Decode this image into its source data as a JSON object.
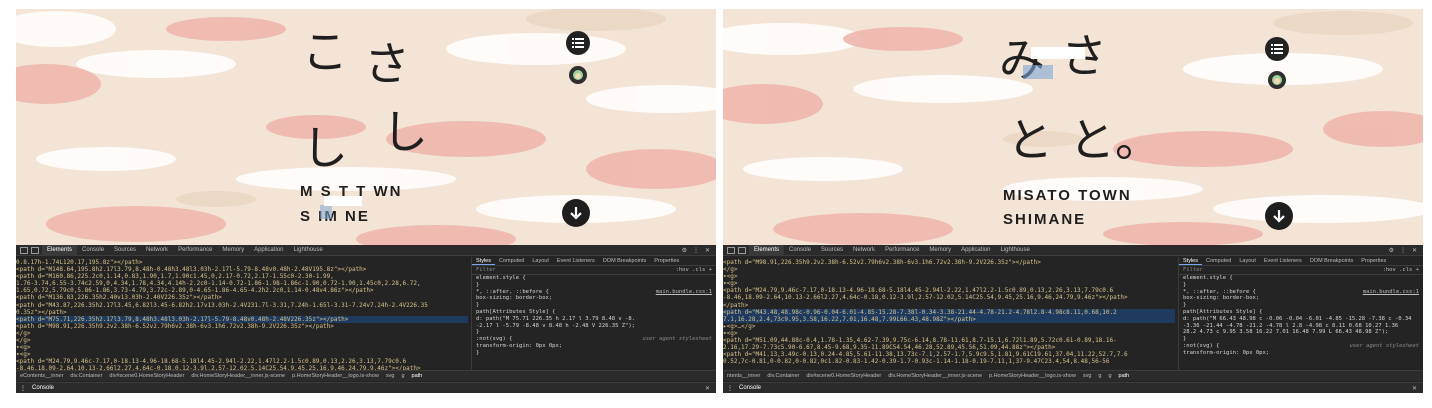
{
  "left": {
    "kana_top_left": "こ",
    "kana_top_right": "さ",
    "kana_mid": "し",
    "kana_mid2": "し",
    "logo_line1": "M S  T   T WN",
    "logo_line2": "S IM NE"
  },
  "right": {
    "kana_top_left": "み",
    "kana_top_right": "さ",
    "kana_mid_left": "と",
    "kana_mid_right": "と。",
    "logo_line1": "MISATO TOWN",
    "logo_line2": "SHIMANE"
  },
  "devtools": {
    "tabs_left": [
      "Elements",
      "Console",
      "Sources",
      "Network",
      "Performance",
      "Memory",
      "Application",
      "Lighthouse"
    ],
    "tabs_right": [
      "Elements",
      "Console",
      "Sources",
      "Network",
      "Performance",
      "Memory",
      "Application",
      "Lighthouse"
    ],
    "style_tabs": [
      "Styles",
      "Computed",
      "Layout",
      "Event Listeners",
      "DOM Breakpoints",
      "Properties"
    ],
    "filter_placeholder": "Filter",
    "filter_right": ":hov  .cls  +",
    "left_elements": [
      "            0.8.17h-1.74L120.17,195.8z\"></path>",
      "            <path d=\"M148.64,195.8h2.17l3.79,8.48h-0.48h3.48l3.03h-2.17l-5.79-8.48v0.48h-2.48V195.8z\"></path>",
      "            <path d=\"M160.86,225.2c0,1.14,0.83,1.90,1.7,1.90c1.45,0,2.17-0.72,2.17-1.55c0-2.30-1.99,",
      "            1.76-3.74,6.55-3.74c2.59,0,4.34,1.78,4.34,4.14h-2.2c0-1.14-0.72-1.86-1.98-1.86c-1.90,0.72-1.90,1.45c0,2.28,6.72,",
      "            1.65,0.72,5.79c0,5.86-1.86,3.73-4.79,3.72c-2.89,0-4.65-1.86-4.65-4.2h2.2c0,1.14-0.48v4.86z\"></path>",
      "            <path d=\"M136.83,226.35h2.40v13.03h-2.40V226.35z\"></path>",
      "            <path d=\"M43.87,226.35h2.17l3.45,6.82l3.45-6.82h2.17v13.03h-2.4V231.7l-3.31,7.24h-1.65l-3.31-7.24v7.24h-2.4V226.35",
      "            0.35z\"></path>",
      "            <path d=\"M75.71,226.35h2.17l3.79,8.48h3.48l3.03h-2.17l-5.79-8.48v0.48h-2.48V226.35z\"></path>",
      "            <path d=\"M98.91,226.35h9.2v2.38h-6.52v2.79h6v2.38h-6v3.1h6.72v2.38h-9.2V226.35z\"></path>",
      "          </g>",
      "        </g>",
      "      ▾<g>",
      "        ▾<g>",
      "            <path d=\"M24.79,9.46c-7.17,0-18.13-4.96-18.68-5.18l4.45-2.94l-2.22,1.47l2.2-1.5c0.89,0.13,2.26,3.13,7.79c0.6",
      "            -8.46,18.09-2.64,10.13-2.66l2.27,4.64c-0.18,0.12-3.9l,2.57-12.02,5.14C25.54,9.45,25.16,9.46,24.79,9.46z\"></path>"
    ],
    "right_elements": [
      "            <path d=\"M98.91,226.35h9.2v2.38h-6.52v2.79h6v2.38h-6v3.1h6.72v2.38h-9.2V226.35z\"></path>",
      "          </g>",
      "        ▾<g>",
      "          ▾<g>",
      "            <path d=\"M24.79,9.46c-7.17,0-18.13-4.96-18.68-5.18l4.45-2.94l-2.22,1.47l2.2-1.5c0.89,0.13,2.26,3.13,7.79c0.6",
      "            -8.46,18.09-2.64,10.13-2.66l2.27,4.64c-0.18,0.12-3.9l,2.57-12.02,5.14C25.54,9.45,25.16,9.46,24.79,9.46z\"></path>",
      "            </path>",
      "            <path d=\"M43.48,48.98c-0.96-0.04-6.01-4.85-15.28-7.38l-0.34-3.38-21.44-4.78-21.2-4.78l2.8-4.98c8.11,0.68,10.2",
      "            7.1,16.28,2.4,73c9.95,3.58,16.22,7.01,16.48,7.99L66.43,48.98Z\"></path>",
      "          ▸<g>…</g>",
      "          ▾<g>",
      "            <path d=\"M51.09,44.88c-0.4,1.78-1.35,4.62-7.39,9.75c-6.14,8.78-11.61,8.7-15.1,6.72l1.89,5.72c0.61-0.89,18.16-",
      "            2.16,17.29-7.73c5.90-6.67,8.45-9.68,9.35-11.89C54.54,46.28,52.89,45.56,51.09,44.88z\"></path>",
      "            <path d=\"M41.13,3.49c-0.13,0.24-4.85,5.61-11.38,13.73c-7.1,2.57-1.7,5.9c9.5,1.81,9.61C19.61,37.04,11.22,52.7,7.6",
      "            0.52,7c-0.81,0-0.82,0-0.82,0c1.82-0.83-1.42-0.39-1.7-0.93c-1.14-1.18-0.19-7.11,1,37-9.47C23.4,54,8.48,56-56"
    ],
    "left_styles": [
      "element.style {",
      "}",
      "*, ::after, ::before {",
      "  box-sizing: border-box;",
      "}",
      "path[Attributes Style] {",
      "  d: path(\"M 75.71 226.35 h 2.17 l 3.79 8.48 v -8.",
      "    -2.17 l -5.79 -8.48 v 8.48 h -2.48 V 226.35 Z\");",
      "}",
      ":not(svg) {",
      "  transform-origin: 0px 0px;",
      "}"
    ],
    "right_styles": [
      "element.style {",
      "}",
      "*, ::after, ::before {",
      "  box-sizing: border-box;",
      "}",
      "path[Attributes Style] {",
      "  d: path(\"M 66.43 48.98 c -0.06 -0.04 -6.01 -4.85 -15.28 -7.38 c -0.34",
      "    -3.36 -21.44 -4.78 -21.2 -4.78 l 2.8 -4.98 c 8.11 0.68 10.27 1.36",
      "    28.2 4.73 c 9.95 3.58 16.22 7.01 16.48 7.99 L 66.43 48.98 Z\");",
      "}",
      ":not(svg) {",
      "  transform-origin: 0px 0px;"
    ],
    "source_link": "main.bundle.css:1",
    "user_agent_label": "user agent stylesheet",
    "crumbs_left": [
      "eContents__inner",
      "div.Container",
      "div#scene0.HomeStoryHeader",
      "div.HomeStoryHeader__inner.js-scene",
      "p.HomeStoryHeader__logo.is-show",
      "svg",
      "g",
      "path"
    ],
    "crumbs_right": [
      "ntents__inner",
      "div.Container",
      "div#scene0.HomeStoryHeader",
      "div.HomeStoryHeader__inner.js-scene",
      "p.HomeStoryHeader__logo.is-show",
      "svg",
      "g",
      "g",
      "path"
    ],
    "console_label": "Console"
  },
  "colors": {
    "bg": "#f3e4d6",
    "cloud_pink": "#efb7ae",
    "cloud_light": "#ffffff",
    "devtools_bg": "#242424"
  }
}
